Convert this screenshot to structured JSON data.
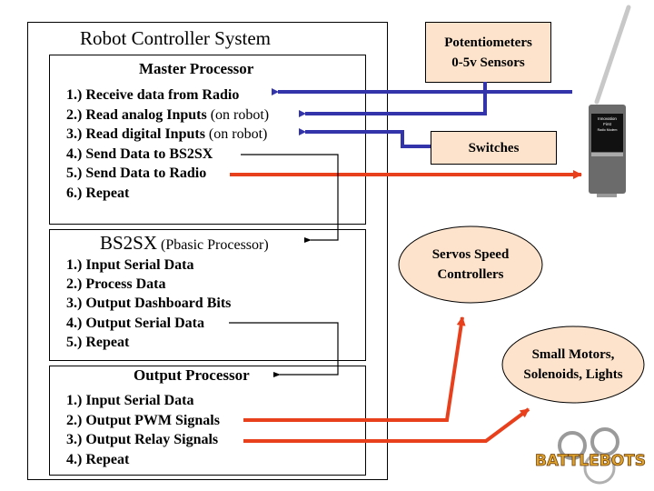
{
  "diagram": {
    "title": "Robot Controller System",
    "master": {
      "title": "Master Processor",
      "items": [
        {
          "text": "1.) Receive data from Radio",
          "note": ""
        },
        {
          "text": "2.) Read analog Inputs",
          "note": " (on robot)"
        },
        {
          "text": "3.) Read digital Inputs",
          "note": " (on robot)"
        },
        {
          "text": "4.) Send Data to BS2SX",
          "note": ""
        },
        {
          "text": "5.) Send Data to Radio",
          "note": ""
        },
        {
          "text": "6.) Repeat",
          "note": ""
        }
      ]
    },
    "bs2sx": {
      "title": "BS2SX",
      "subtitle": " (Pbasic Processor)",
      "items": [
        "1.) Input Serial Data",
        "2.) Process Data",
        "3.) Output Dashboard Bits",
        "4.) Output Serial Data",
        "5.) Repeat"
      ]
    },
    "output": {
      "title": "Output Processor",
      "items": [
        "1.) Input Serial Data",
        "2.) Output PWM Signals",
        "3.) Output Relay Signals",
        "4.) Repeat"
      ]
    },
    "peripherals": {
      "potentiometers": [
        "Potentiometers",
        "0-5v Sensors"
      ],
      "switches": "Switches",
      "servos": [
        "Servos Speed",
        "Controllers"
      ],
      "motors": [
        "Small Motors,",
        "Solenoids, Lights"
      ]
    },
    "radio_modem": {
      "brand_line1": "Innovation",
      "brand_line2": "First",
      "model": "Radio Modem"
    },
    "logo": "BATTLEBOTS",
    "colors": {
      "input_wire": "#3333aa",
      "output_wire": "#e8401c",
      "peripheral_fill": "#fde3cc",
      "modem_body": "#6b6b6b",
      "antenna": "#c8c8c8"
    }
  }
}
